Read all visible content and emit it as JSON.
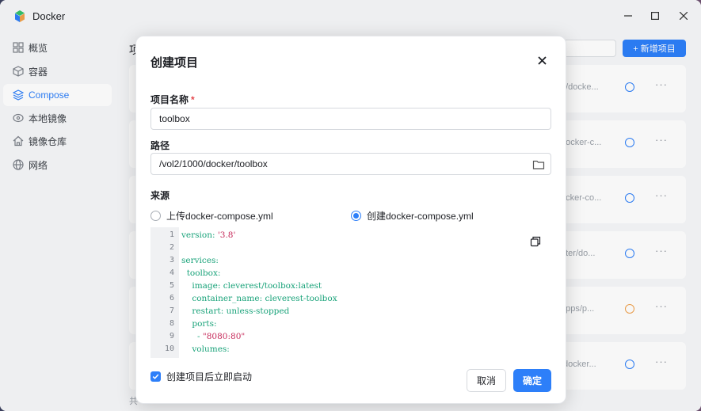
{
  "app": {
    "title": "Docker",
    "accent": "#2d7ff9"
  },
  "sidebar": {
    "items": [
      {
        "label": "概览",
        "icon": "grid-icon"
      },
      {
        "label": "容器",
        "icon": "cube-icon"
      },
      {
        "label": "Compose",
        "icon": "layers-icon",
        "active": true
      },
      {
        "label": "本地镜像",
        "icon": "disc-icon"
      },
      {
        "label": "镜像仓库",
        "icon": "home-icon"
      },
      {
        "label": "网络",
        "icon": "globe-icon"
      }
    ]
  },
  "background": {
    "title": "项",
    "add_button": "+ 新增项目",
    "footer": "共",
    "cards": [
      {
        "path": "e/docke..."
      },
      {
        "path": "docker-c..."
      },
      {
        "path": "ocker-co..."
      },
      {
        "path": "nter/do..."
      },
      {
        "path": "apps/p..."
      },
      {
        "path": "/docker..."
      }
    ]
  },
  "dialog": {
    "title": "创建项目",
    "name_label": "项目名称",
    "name_required": "*",
    "name_value": "toolbox",
    "path_label": "路径",
    "path_value": "/vol2/1000/docker/toolbox",
    "source_label": "来源",
    "source_options": [
      {
        "label": "上传docker-compose.yml",
        "selected": false
      },
      {
        "label": "创建docker-compose.yml",
        "selected": true
      }
    ],
    "code_lines": [
      {
        "n": "1",
        "indent": "",
        "key": "version:",
        "val": " '3.8'",
        "val_class": "s"
      },
      {
        "n": "2",
        "indent": "",
        "key": "",
        "val": "",
        "val_class": ""
      },
      {
        "n": "3",
        "indent": "",
        "key": "services:",
        "val": "",
        "val_class": ""
      },
      {
        "n": "4",
        "indent": "  ",
        "key": "toolbox:",
        "val": "",
        "val_class": ""
      },
      {
        "n": "5",
        "indent": "    ",
        "key": "image:",
        "val": " cleverest/toolbox:latest",
        "val_class": "k"
      },
      {
        "n": "6",
        "indent": "    ",
        "key": "container_name:",
        "val": " cleverest-toolbox",
        "val_class": "k"
      },
      {
        "n": "7",
        "indent": "    ",
        "key": "restart:",
        "val": " unless-stopped",
        "val_class": "k"
      },
      {
        "n": "8",
        "indent": "    ",
        "key": "ports:",
        "val": "",
        "val_class": ""
      },
      {
        "n": "9",
        "indent": "      ",
        "key": "- ",
        "val": "\"8080:80\"",
        "val_class": "s"
      },
      {
        "n": "10",
        "indent": "    ",
        "key": "volumes:",
        "val": "",
        "val_class": ""
      }
    ],
    "autostart_label": "创建项目后立即启动",
    "cancel_label": "取消",
    "ok_label": "确定"
  }
}
